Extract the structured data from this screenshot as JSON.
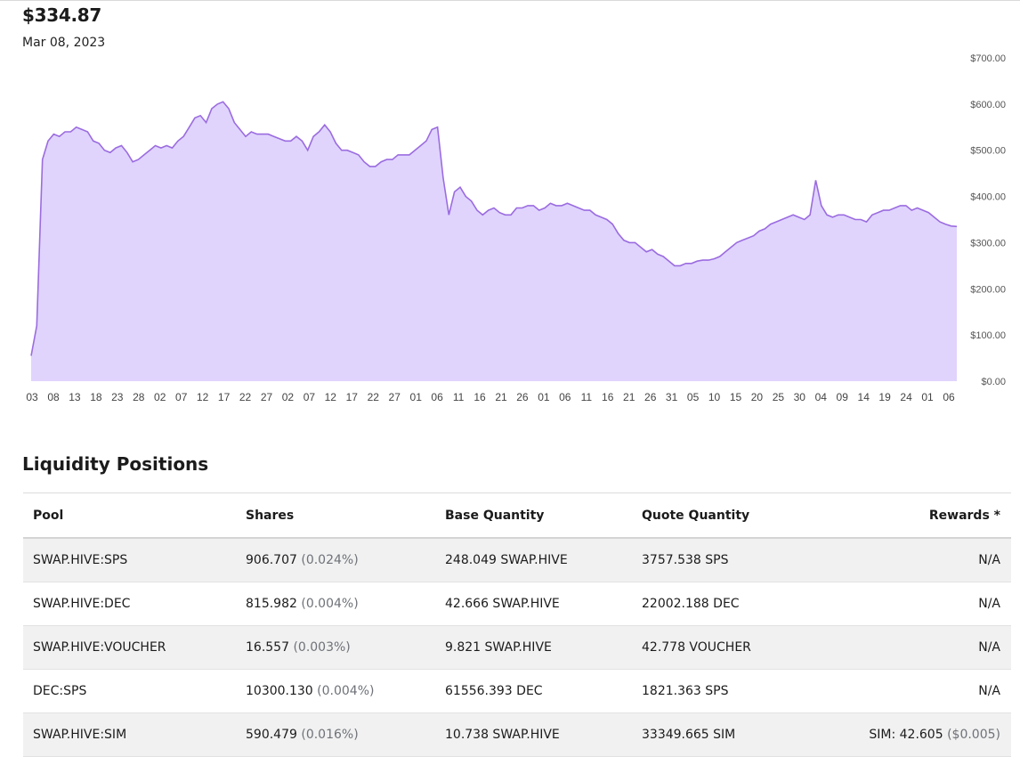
{
  "header": {
    "price": "$334.87",
    "date": "Mar 08, 2023"
  },
  "chart_data": {
    "type": "area",
    "color_line": "#9b6ce0",
    "color_fill": "#e0d4fd",
    "ylim": [
      0,
      700
    ],
    "y_ticks": [
      {
        "value": 700,
        "label": "$700.00"
      },
      {
        "value": 600,
        "label": "$600.00"
      },
      {
        "value": 500,
        "label": "$500.00"
      },
      {
        "value": 400,
        "label": "$400.00"
      },
      {
        "value": 300,
        "label": "$300.00"
      },
      {
        "value": 200,
        "label": "$200.00"
      },
      {
        "value": 100,
        "label": "$100.00"
      },
      {
        "value": 0,
        "label": "$0.00"
      }
    ],
    "x_ticks": [
      "03",
      "08",
      "13",
      "18",
      "23",
      "28",
      "02",
      "07",
      "12",
      "17",
      "22",
      "27",
      "02",
      "07",
      "12",
      "17",
      "22",
      "27",
      "01",
      "06",
      "11",
      "16",
      "21",
      "26",
      "01",
      "06",
      "11",
      "16",
      "21",
      "26",
      "31",
      "05",
      "10",
      "15",
      "20",
      "25",
      "30",
      "04",
      "09",
      "14",
      "19",
      "24",
      "01",
      "06"
    ],
    "series": [
      {
        "values": [
          55,
          120,
          480,
          520,
          535,
          530,
          540,
          540,
          550,
          545,
          540,
          520,
          515,
          500,
          495,
          505,
          510,
          495,
          475,
          480,
          490,
          500,
          510,
          505,
          510,
          505,
          520,
          530,
          550,
          570,
          575,
          560,
          590,
          600,
          605,
          590,
          560,
          545,
          530,
          540,
          535,
          535,
          535,
          530,
          525,
          520,
          520,
          530,
          520,
          500,
          530,
          540,
          555,
          540,
          515,
          500,
          500,
          495,
          490,
          475,
          465,
          465,
          475,
          480,
          480,
          490,
          490,
          490,
          500,
          510,
          520,
          545,
          550,
          440,
          360,
          410,
          420,
          400,
          390,
          370,
          360,
          370,
          375,
          365,
          360,
          360,
          375,
          375,
          380,
          380,
          370,
          375,
          385,
          380,
          380,
          385,
          380,
          375,
          370,
          370,
          360,
          355,
          350,
          340,
          320,
          305,
          300,
          300,
          290,
          280,
          285,
          275,
          270,
          260,
          250,
          250,
          255,
          255,
          260,
          262,
          262,
          265,
          270,
          280,
          290,
          300,
          305,
          310,
          315,
          325,
          330,
          340,
          345,
          350,
          355,
          360,
          355,
          350,
          360,
          435,
          380,
          360,
          355,
          360,
          360,
          355,
          350,
          350,
          345,
          360,
          365,
          370,
          370,
          375,
          380,
          380,
          370,
          375,
          370,
          365,
          355,
          345,
          340,
          336,
          334.87
        ]
      }
    ]
  },
  "positions": {
    "title": "Liquidity Positions",
    "columns": [
      "Pool",
      "Shares",
      "Base Quantity",
      "Quote Quantity",
      "Rewards *"
    ],
    "rows": [
      {
        "pool": "SWAP.HIVE:SPS",
        "shares": "906.707",
        "share_pct": "(0.024%)",
        "base": "248.049 SWAP.HIVE",
        "quote": "3757.538 SPS",
        "rewards": "N/A",
        "rewards_usd": ""
      },
      {
        "pool": "SWAP.HIVE:DEC",
        "shares": "815.982",
        "share_pct": "(0.004%)",
        "base": "42.666 SWAP.HIVE",
        "quote": "22002.188 DEC",
        "rewards": "N/A",
        "rewards_usd": ""
      },
      {
        "pool": "SWAP.HIVE:VOUCHER",
        "shares": "16.557",
        "share_pct": "(0.003%)",
        "base": "9.821 SWAP.HIVE",
        "quote": "42.778 VOUCHER",
        "rewards": "N/A",
        "rewards_usd": ""
      },
      {
        "pool": "DEC:SPS",
        "shares": "10300.130",
        "share_pct": "(0.004%)",
        "base": "61556.393 DEC",
        "quote": "1821.363 SPS",
        "rewards": "N/A",
        "rewards_usd": ""
      },
      {
        "pool": "SWAP.HIVE:SIM",
        "shares": "590.479",
        "share_pct": "(0.016%)",
        "base": "10.738 SWAP.HIVE",
        "quote": "33349.665 SIM",
        "rewards": "SIM: 42.605",
        "rewards_usd": "($0.005)"
      }
    ]
  }
}
